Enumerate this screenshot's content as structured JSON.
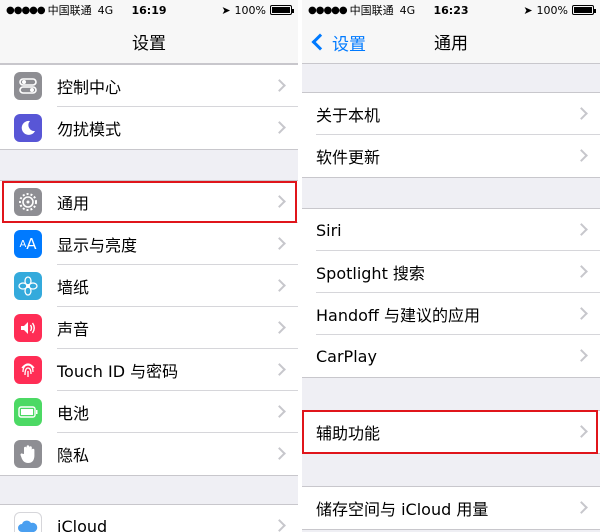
{
  "left": {
    "status": {
      "carrier": "中国联通",
      "network": "4G",
      "time": "16:19",
      "battery": "100%"
    },
    "nav_title": "设置",
    "groups": [
      {
        "items": [
          {
            "label": "控制中心",
            "icon": "control-center-icon",
            "color": "#8e8e93"
          },
          {
            "label": "勿扰模式",
            "icon": "moon-icon",
            "color": "#5856d6"
          }
        ]
      },
      {
        "items": [
          {
            "label": "通用",
            "icon": "gear-icon",
            "color": "#8e8e93",
            "highlighted": true
          },
          {
            "label": "显示与亮度",
            "icon": "text-size-icon",
            "color": "#007aff"
          },
          {
            "label": "墙纸",
            "icon": "flower-icon",
            "color": "#34aadc"
          },
          {
            "label": "声音",
            "icon": "speaker-icon",
            "color": "#ff2d55"
          },
          {
            "label": "Touch ID 与密码",
            "icon": "fingerprint-icon",
            "color": "#ff2d55"
          },
          {
            "label": "电池",
            "icon": "battery-icon",
            "color": "#4cd964"
          },
          {
            "label": "隐私",
            "icon": "hand-icon",
            "color": "#8e8e93"
          }
        ]
      },
      {
        "items": [
          {
            "label": "iCloud",
            "icon": "cloud-icon",
            "color": "#ffffff"
          }
        ]
      }
    ]
  },
  "right": {
    "status": {
      "carrier": "中国联通",
      "network": "4G",
      "time": "16:23",
      "battery": "100%"
    },
    "back_label": "设置",
    "nav_title": "通用",
    "groups": [
      {
        "items": [
          {
            "label": "关于本机"
          },
          {
            "label": "软件更新"
          }
        ]
      },
      {
        "items": [
          {
            "label": "Siri"
          },
          {
            "label": "Spotlight 搜索"
          },
          {
            "label": "Handoff 与建议的应用"
          },
          {
            "label": "CarPlay"
          }
        ]
      },
      {
        "items": [
          {
            "label": "辅助功能",
            "highlighted": true
          }
        ]
      },
      {
        "items": [
          {
            "label": "储存空间与 iCloud 用量"
          }
        ]
      }
    ]
  },
  "colors": {
    "highlight": "#e0151b",
    "accent": "#007aff"
  }
}
